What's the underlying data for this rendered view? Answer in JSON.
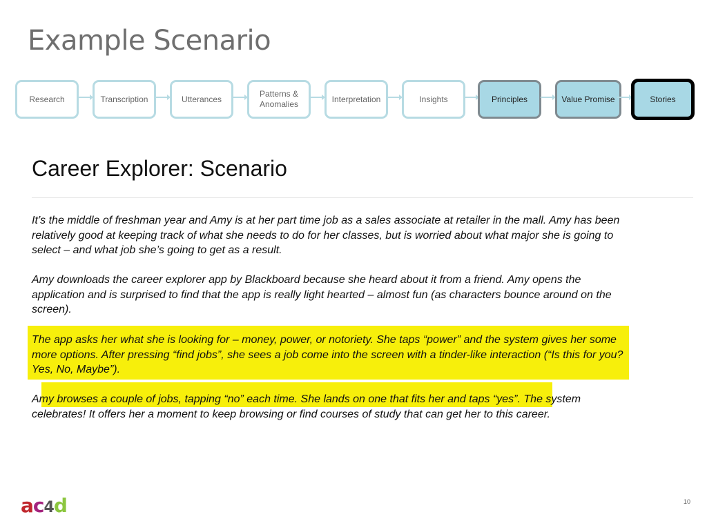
{
  "header": {
    "title": "Example Scenario"
  },
  "process": {
    "steps": [
      {
        "label": "Research",
        "state": "default"
      },
      {
        "label": "Transcription",
        "state": "default"
      },
      {
        "label": "Utterances",
        "state": "default"
      },
      {
        "label": "Patterns & Anomalies",
        "state": "default"
      },
      {
        "label": "Interpretation",
        "state": "default"
      },
      {
        "label": "Insights",
        "state": "default"
      },
      {
        "label": "Principles",
        "state": "done"
      },
      {
        "label": "Value Promise",
        "state": "done"
      },
      {
        "label": "Stories",
        "state": "current"
      }
    ]
  },
  "main": {
    "subtitle": "Career Explorer: Scenario",
    "paragraphs": [
      "It’s the middle of freshman year and Amy is at her part time job as a sales associate at retailer in the mall. Amy has been relatively good at keeping track of what she needs to do for her classes, but is worried about what major she is going to select – and what job she’s going to get as a result.",
      "Amy downloads the career explorer app by Blackboard because she heard about it from a friend. Amy opens the application and is surprised to find that the app is really light hearted – almost fun (as characters bounce around on the screen).",
      "The app asks her what she is looking for – money, power, or notoriety.  She taps “power” and the system gives her some more options.  After pressing “find jobs”, she sees a job come into the screen with a tinder-like interaction (“Is this for you? Yes, No, Maybe”).",
      "Amy browses a couple of jobs, tapping “no” each time.  She lands on one that fits her and taps “yes”.  The system celebrates!  It offers her a moment to keep browsing or find courses of study that can get her to this career."
    ],
    "highlight_color": "#f7ef0b"
  },
  "footer": {
    "logo": "ac4d",
    "logo_colors": [
      "#c0272d",
      "#a4237e",
      "#555555",
      "#8cc63f"
    ],
    "page_number": "10"
  }
}
